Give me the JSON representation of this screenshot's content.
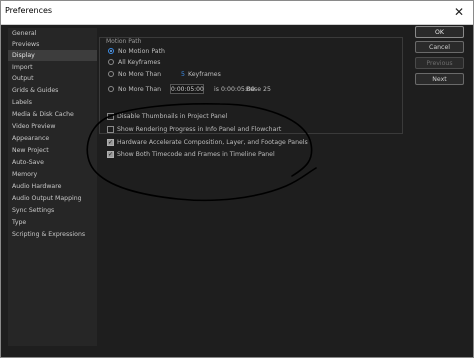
{
  "window": {
    "title": "Preferences",
    "close_glyph": "✕"
  },
  "sidebar": {
    "items": [
      {
        "label": "General"
      },
      {
        "label": "Previews"
      },
      {
        "label": "Display",
        "active": true
      },
      {
        "label": "Import"
      },
      {
        "label": "Output"
      },
      {
        "label": "Grids & Guides"
      },
      {
        "label": "Labels"
      },
      {
        "label": "Media & Disk Cache"
      },
      {
        "label": "Video Preview"
      },
      {
        "label": "Appearance"
      },
      {
        "label": "New Project"
      },
      {
        "label": "Auto-Save"
      },
      {
        "label": "Memory"
      },
      {
        "label": "Audio Hardware"
      },
      {
        "label": "Audio Output Mapping"
      },
      {
        "label": "Sync Settings"
      },
      {
        "label": "Type"
      },
      {
        "label": "Scripting & Expressions"
      }
    ]
  },
  "motion_path": {
    "group_title": "Motion Path",
    "no_motion_path": "No Motion Path",
    "all_keyframes": "All Keyframes",
    "no_more_than_kf": "No More Than",
    "kf_value": "5",
    "kf_unit": "Keyframes",
    "no_more_than_tc": "No More Than",
    "tc_value": "0:00:05:00",
    "is_label": "is",
    "tc2_value": "0:00:05:00",
    "base_label": "Base 25",
    "selected": "no_motion_path"
  },
  "options": [
    {
      "label": "Disable Thumbnails in Project Panel",
      "checked": false
    },
    {
      "label": "Show Rendering Progress in Info Panel and Flowchart",
      "checked": false
    },
    {
      "label": "Hardware Accelerate Composition, Layer, and Footage Panels",
      "checked": true
    },
    {
      "label": "Show Both Timecode and Frames in Timeline Panel",
      "checked": true
    }
  ],
  "buttons": {
    "ok": "OK",
    "cancel": "Cancel",
    "previous": "Previous",
    "next": "Next"
  },
  "colors": {
    "accent": "#3d8ee8",
    "background": "#1e1e1e",
    "sidebar": "#262626",
    "annotation": "#000000"
  }
}
